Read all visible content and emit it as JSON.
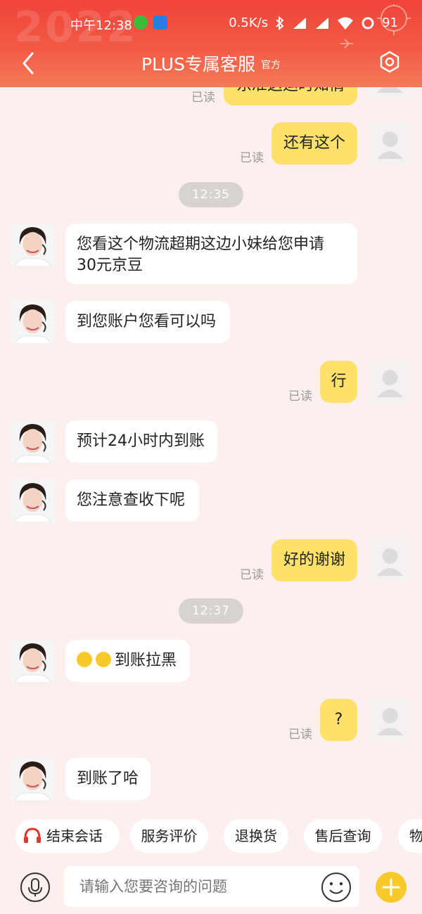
{
  "status_bar": {
    "time": "中午12:38",
    "network_speed": "0.5K/s",
    "battery": "91"
  },
  "header": {
    "title": "PLUS专属客服",
    "badge": "官方",
    "decoration_text": "2022"
  },
  "messages": {
    "m0": {
      "text": "东准这运时知情",
      "read": "已读"
    },
    "m1": {
      "text": "还有这个",
      "read": "已读"
    },
    "ts1": "12:35",
    "m2_line1": "您看这个物流超期这边小妹给您申请",
    "m2_line2": "30元京豆",
    "m3": "到您账户您看可以吗",
    "m4": {
      "text": "行",
      "read": "已读"
    },
    "m5": "预计24小时内到账",
    "m6": "您注意查收下呢",
    "m7": {
      "text": "好的谢谢",
      "read": "已读"
    },
    "ts2": "12:37",
    "m8": "到账拉黑",
    "m9": {
      "text": "?",
      "read": "已读"
    },
    "m10": "到账了哈"
  },
  "quick_actions": {
    "end_session": "结束会话",
    "rate_service": "服务评价",
    "return_exchange": "退换货",
    "after_sales": "售后查询",
    "logistics": "物"
  },
  "input_bar": {
    "placeholder": "请输入您要咨询的问题"
  },
  "colors": {
    "header_red": "#f0433a",
    "user_bubble": "#fde16a",
    "plus_button": "#f9c92c"
  }
}
